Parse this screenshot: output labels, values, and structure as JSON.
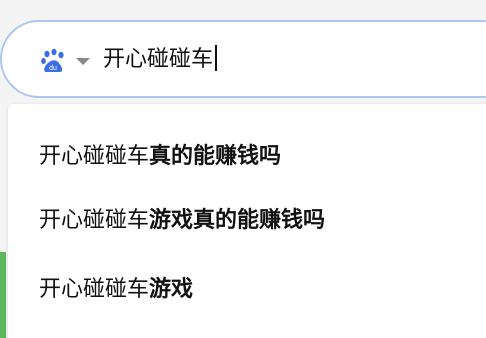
{
  "search": {
    "engine_icon": "baidu-paw-icon",
    "engine_badge": "du",
    "dropdown_icon": "chevron-down-icon",
    "query": "开心碰碰车"
  },
  "suggestions": [
    {
      "prefix": "开心碰碰车",
      "completion": "真的能赚钱吗"
    },
    {
      "prefix": "开心碰碰车",
      "completion": "游戏真的能赚钱吗"
    },
    {
      "prefix": "开心碰碰车",
      "completion": "游戏"
    }
  ],
  "colors": {
    "search_border": "#aac8f2",
    "engine_blue": "#3b6ee8",
    "side_accent": "#5cb85c"
  }
}
